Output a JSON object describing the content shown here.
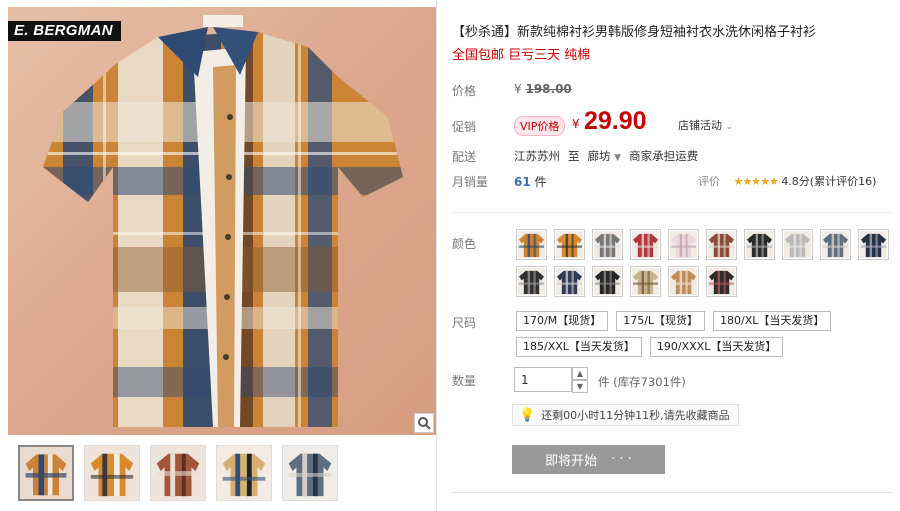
{
  "brand": {
    "logo_text": "E. BERGMAN"
  },
  "product": {
    "title": "【秒杀通】新款纯棉衬衫男韩版修身短袖衬衣水洗休闲格子衬衫",
    "subtitle": "全国包邮 巨亏三天 纯棉"
  },
  "price": {
    "label": "价格",
    "original_currency": "¥",
    "original": "198.00",
    "promo_label": "促销",
    "vip_tag": "VIP价格",
    "currency": "¥",
    "current": "29.90",
    "activity_link": "店铺活动"
  },
  "shipping": {
    "label": "配送",
    "from": "江苏苏州",
    "to_word": "至",
    "to": "廊坊",
    "fee": "商家承担运费"
  },
  "sales": {
    "label": "月销量",
    "count": "61",
    "unit": "件",
    "rating_label": "评价",
    "stars": "★★★★★",
    "rating_text": "4.8分(累计评价16)"
  },
  "color": {
    "label": "颜色",
    "swatches": [
      "orange-plaid",
      "orange-plaid-2",
      "grey-check",
      "red-plaid",
      "light-pink",
      "multi-check",
      "black-check",
      "grey-plain",
      "slate-check",
      "navy-check",
      "black-check-2",
      "navy-check-2",
      "black-check-3",
      "beige-plaid",
      "tan-plaid",
      "black-check-4"
    ]
  },
  "size": {
    "label": "尺码",
    "options": [
      "170/M【现货】",
      "175/L【现货】",
      "180/XL【当天发货】",
      "185/XXL【当天发货】",
      "190/XXXL【当天发货】"
    ]
  },
  "quantity": {
    "label": "数量",
    "value": "1",
    "unit": "件",
    "stock": "(库存7301件)"
  },
  "notice": {
    "text": "还剩00小时11分钟11秒,请先收藏商品"
  },
  "buy": {
    "label": "即将开始",
    "dots": "· · ·"
  },
  "colors": {
    "accent": "#c40000",
    "link": "#3a6fb5",
    "button": "#999999"
  }
}
